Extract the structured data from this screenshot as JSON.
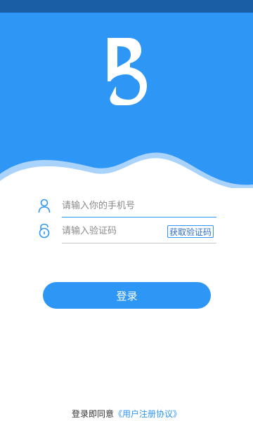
{
  "colors": {
    "primary": "#2e96f5",
    "status_bar": "#1a5ea6",
    "wave_light": "#a9d3fb"
  },
  "logo": {
    "name": "app-logo"
  },
  "form": {
    "phone": {
      "placeholder": "请输入你的手机号",
      "icon": "user-icon"
    },
    "code": {
      "placeholder": "请输入验证码",
      "icon": "lock-icon",
      "get_code_label": "获取验证码"
    }
  },
  "login_label": "登录",
  "agreement": {
    "prefix": "登录即同意",
    "link": "《用户注册协议》"
  }
}
